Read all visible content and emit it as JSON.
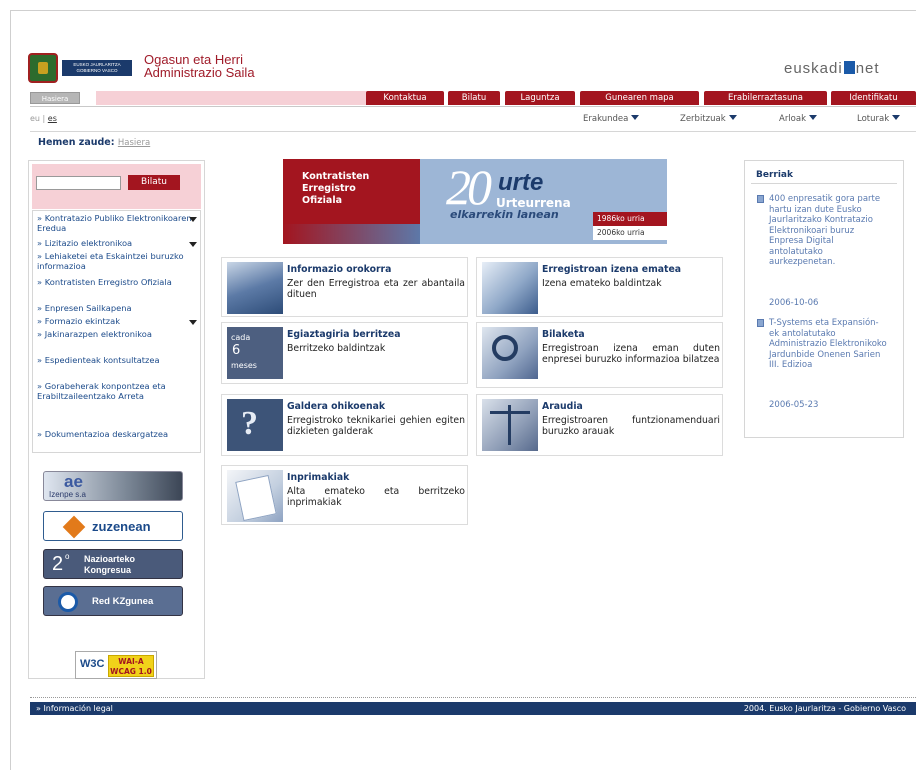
{
  "header": {
    "gov_band": "EUSKO JAURLARITZA GOBIERNO VASCO",
    "dept_line1": "Ogasun eta Herri",
    "dept_line2": "Administrazio Saila",
    "euskadi_left": "euskadi",
    "euskadi_right": "net"
  },
  "topmenu": {
    "home": "Hasiera",
    "tabs": [
      "Kontaktua",
      "Bilatu",
      "Laguntza",
      "Gunearen mapa",
      "Erabilerraztasuna",
      "Identifikatu"
    ]
  },
  "lang": {
    "eu": "eu",
    "sep": "|",
    "es": "es"
  },
  "secnav": [
    "Erakundea",
    "Zerbitzuak",
    "Arloak",
    "Loturak"
  ],
  "breadcrumb": {
    "label": "Hemen zaude:",
    "link": "Hasiera"
  },
  "search": {
    "value": "",
    "button": "Bilatu"
  },
  "left_menu": [
    "» Kontratazio Publiko Elektronikoaren Eredua",
    "» Lizitazio elektronikoa",
    "» Lehiaketei eta Eskaintzei buruzko informazioa",
    "» Kontratisten Erregistro Ofiziala",
    "» Enpresen Sailkapena",
    "» Formazio ekintzak",
    "» Jakinarazpen elektronikoa",
    "» Espedienteak kontsultatzea",
    "» Gorabeherak konpontzea eta Erabiltzaileentzako Arreta",
    "» Dokumentazioa deskargatzea"
  ],
  "banners": {
    "izenpe_logo": "ae",
    "izenpe": "Izenpe s.a",
    "zuzenean": "zuzenean",
    "kongresua_num": "2",
    "kongresua_sup": "o",
    "kongresua": "Nazioarteko Kongresua",
    "kzgunea": "Red KZgunea",
    "w3c": "W3C",
    "wai": "WAI-A",
    "wcag": "WCAG 1.0"
  },
  "main_banner": {
    "line1": "Kontratisten",
    "line2": "Erregistro",
    "line3": "Ofiziala",
    "big": "20",
    "urte": "urte",
    "urteurrena": "Urteurrena",
    "elkarrekin": "elkarrekin lanean",
    "date1": "1986ko urria",
    "date2": "2006ko urria"
  },
  "cards": [
    {
      "title": "Informazio orokorra",
      "desc": "Zer den Erregistroa eta zer abantaila dituen"
    },
    {
      "title": "Erregistroan izena ematea",
      "desc": "Izena emateko baldintzak"
    },
    {
      "title": "Egiaztagiria berritzea",
      "desc": "Berritzeko baldintzak",
      "thumb_cada": "cada",
      "thumb_num": "6",
      "thumb_meses": "meses"
    },
    {
      "title": "Bilaketa",
      "desc": "Erregistroan izena eman duten enpresei buruzko informazioa bilatzea"
    },
    {
      "title": "Galdera ohikoenak",
      "desc": "Erregistroko teknikariei gehien egiten dizkieten galderak"
    },
    {
      "title": "Araudia",
      "desc": "Erregistroaren funtzionamenduari buruzko arauak"
    },
    {
      "title": "Inprimakiak",
      "desc": "Alta emateko eta berritzeko inprimakiak"
    }
  ],
  "news": {
    "title": "Berriak",
    "items": [
      {
        "text": "400 enpresatik gora parte hartu izan dute Eusko Jaurlaritzako Kontratazio Elektronikoari buruz Enpresa Digital antolatutako aurkezpenetan.",
        "date": "2006-10-06"
      },
      {
        "text": "T-Systems eta Expansión-ek antolatutako Administrazio Elektronikoko Jardunbide Onenen Sarien III. Edizioa",
        "date": "2006-05-23"
      }
    ]
  },
  "footer": {
    "left": "» Información legal",
    "right": "2004. Eusko Jaurlaritza - Gobierno Vasco"
  },
  "colors": {
    "brand_red": "#a3151f",
    "navy": "#1b3a6b",
    "link_blue": "#1b4a8a",
    "pink": "#f6d0d6"
  }
}
